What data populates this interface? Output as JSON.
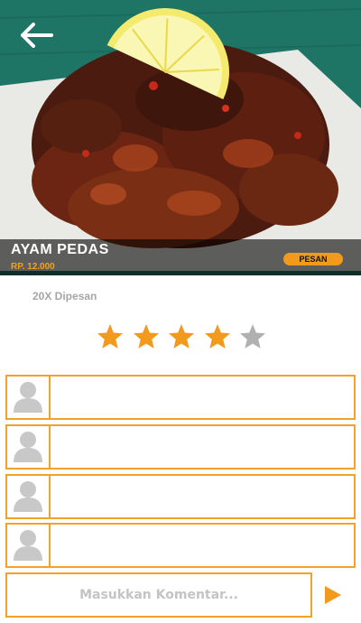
{
  "dish": {
    "name": "AYAM PEDAS",
    "price": "RP. 12.000",
    "order_button_label": "PESAN",
    "order_count": "20X Dipesan"
  },
  "rating": {
    "value": 4,
    "max": 5,
    "filled_color": "#f29a1d",
    "empty_color": "#b0b0b0"
  },
  "comments": [
    {
      "text": ""
    },
    {
      "text": ""
    },
    {
      "text": ""
    },
    {
      "text": ""
    }
  ],
  "comment_input": {
    "placeholder": "Masukkan Komentar...",
    "value": ""
  },
  "icons": {
    "back": "arrow-left-icon",
    "avatar": "user-placeholder-icon",
    "send": "play-triangle-icon",
    "star": "star-icon"
  },
  "colors": {
    "accent": "#f29a1d",
    "border": "#f4a12b",
    "muted_text": "#a6a6a6"
  }
}
